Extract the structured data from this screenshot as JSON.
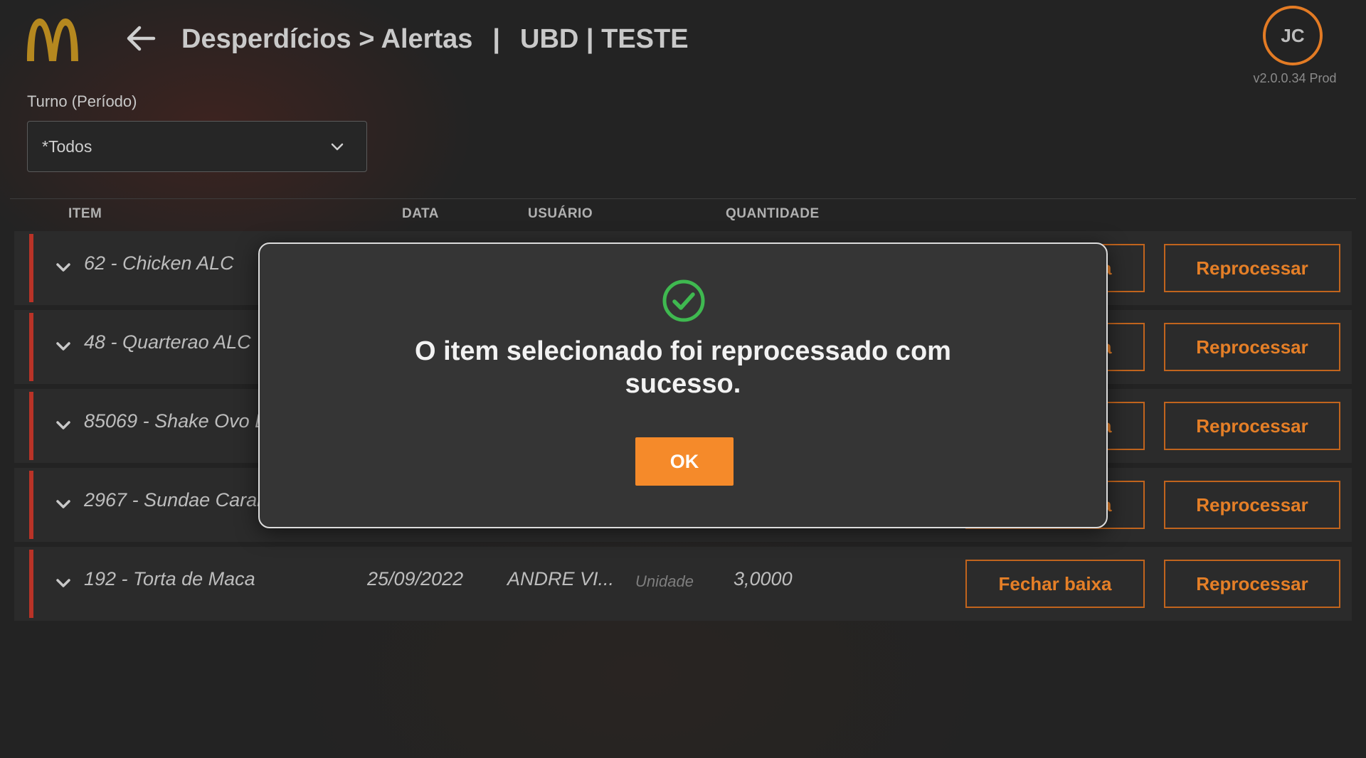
{
  "header": {
    "title": "Desperdícios > Alertas",
    "separator": "|",
    "store": "UBD | TESTE",
    "avatar_initials": "JC",
    "version": "v2.0.0.34 Prod"
  },
  "filter": {
    "label": "Turno (Período)",
    "selected": "*Todos"
  },
  "table": {
    "columns": [
      "ITEM",
      "DATA",
      "USUÁRIO",
      "QUANTIDADE"
    ],
    "rows": [
      {
        "item": "62 - Chicken ALC"
      },
      {
        "item": "48 - Quarterao ALC"
      },
      {
        "item": "85069 - Shake Ovo BL"
      },
      {
        "item": "2967 - Sundae Caram"
      },
      {
        "item": "192 - Torta de Maca",
        "date": "25/09/2022",
        "user": "ANDRE VI...",
        "unit": "Unidade",
        "quantity": "3,0000"
      }
    ],
    "fechar_label": "Fechar baixa",
    "reprocessar_label": "Reprocessar"
  },
  "modal": {
    "message": "O item selecionado foi reprocessado com sucesso.",
    "ok_label": "OK",
    "icon": "check-circle-icon"
  },
  "colors": {
    "accent_orange": "#f58a2a",
    "row_accent_red": "#b93327",
    "success_green": "#3fb950"
  }
}
